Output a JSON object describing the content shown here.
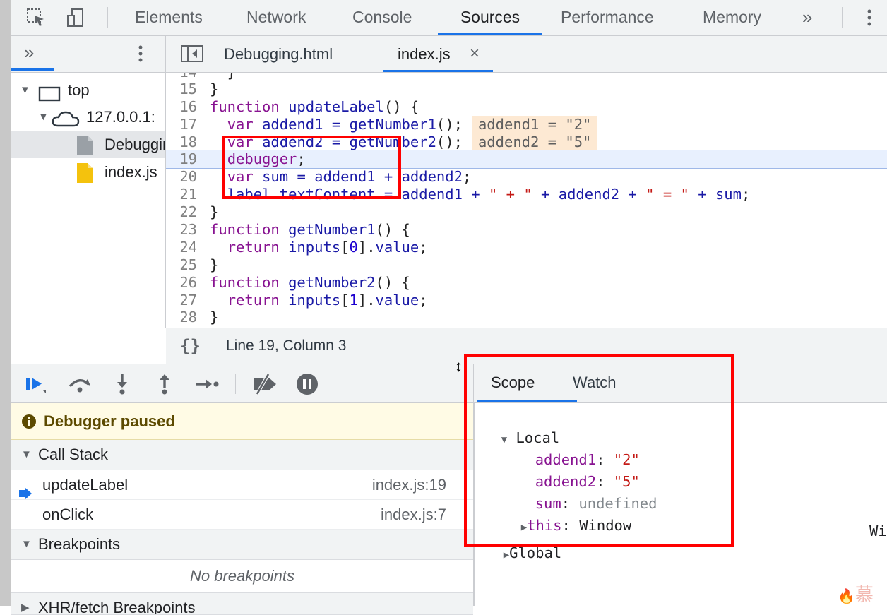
{
  "devtools": {
    "tabs": [
      {
        "label": "Elements"
      },
      {
        "label": "Network"
      },
      {
        "label": "Console"
      },
      {
        "label": "Sources"
      },
      {
        "label": "Performance"
      },
      {
        "label": "Memory"
      }
    ],
    "active_tab": "Sources",
    "more_tabs": "»"
  },
  "navigator": {
    "more": "»",
    "tree": {
      "top": "top",
      "host": "127.0.0.1:",
      "file1": "Debugging.html",
      "file2": "index.js"
    }
  },
  "editor": {
    "tabs": [
      {
        "label": "Debugging.html"
      },
      {
        "label": "index.js"
      }
    ],
    "active_tab": "index.js",
    "close_glyph": "×",
    "lines": [
      {
        "n": "14",
        "code": "  }"
      },
      {
        "n": "15",
        "code": "}"
      },
      {
        "n": "16",
        "code": "function updateLabel() {"
      },
      {
        "n": "17",
        "code": "  var addend1 = getNumber1();",
        "inline": "addend1 = \"2\""
      },
      {
        "n": "18",
        "code": "  var addend2 = getNumber2();",
        "inline": "addend2 = \"5\""
      },
      {
        "n": "19",
        "code": "  debugger;"
      },
      {
        "n": "20",
        "code": "  var sum = addend1 + addend2;"
      },
      {
        "n": "21",
        "code": "  label.textContent = addend1 + \" + \" + addend2 + \" = \" + sum;"
      },
      {
        "n": "22",
        "code": "}"
      },
      {
        "n": "23",
        "code": "function getNumber1() {"
      },
      {
        "n": "24",
        "code": "  return inputs[0].value;"
      },
      {
        "n": "25",
        "code": "}"
      },
      {
        "n": "26",
        "code": "function getNumber2() {"
      },
      {
        "n": "27",
        "code": "  return inputs[1].value;"
      },
      {
        "n": "28",
        "code": "}"
      }
    ],
    "status": {
      "format_glyph": "{}",
      "position": "Line 19, Column 3"
    }
  },
  "debugger": {
    "paused_text": "Debugger paused",
    "call_stack_title": "Call Stack",
    "frames": [
      {
        "name": "updateLabel",
        "location": "index.js:19"
      },
      {
        "name": "onClick",
        "location": "index.js:7"
      }
    ],
    "breakpoints_title": "Breakpoints",
    "no_breakpoints": "No breakpoints",
    "xhr_title": "XHR/fetch Breakpoints"
  },
  "scope": {
    "tabs": [
      {
        "label": "Scope"
      },
      {
        "label": "Watch"
      }
    ],
    "active_tab": "Scope",
    "local_label": "Local",
    "vars": [
      {
        "name": "addend1",
        "value": "\"2\""
      },
      {
        "name": "addend2",
        "value": "\"5\""
      },
      {
        "name": "sum",
        "value": "undefined"
      },
      {
        "name": "this",
        "value": "Window"
      }
    ],
    "global_label": "Global",
    "global_value": "Wi"
  },
  "watermark": "慕课",
  "colors": {
    "accent": "#1a73e8",
    "highlight": "#ff0000",
    "paused_bg": "#fffbe5"
  }
}
